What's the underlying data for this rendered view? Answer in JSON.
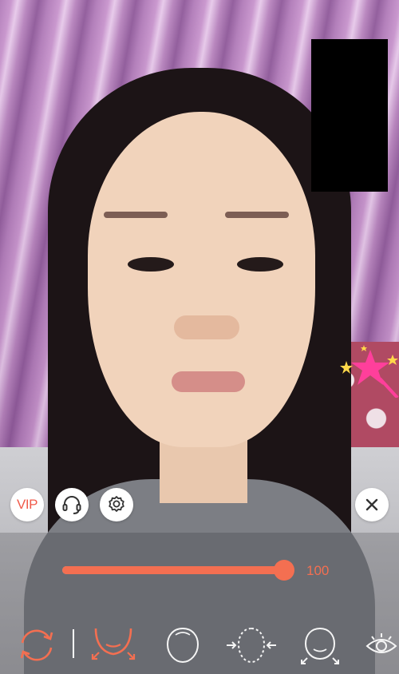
{
  "controls": {
    "vip_label": "VIP",
    "support_icon": "headset-icon",
    "settings_icon": "gear-icon",
    "close_icon": "close-icon"
  },
  "slider": {
    "value": 100,
    "value_label": "100",
    "color": "#f46f51"
  },
  "tools": [
    {
      "icon": "reset-rotate-icon",
      "selected": false
    },
    {
      "icon": "chin-slim-icon",
      "selected": true
    },
    {
      "icon": "face-shape-icon",
      "selected": false
    },
    {
      "icon": "face-narrow-icon",
      "selected": false
    },
    {
      "icon": "face-lift-icon",
      "selected": false
    },
    {
      "icon": "eye-icon",
      "selected": false
    }
  ]
}
